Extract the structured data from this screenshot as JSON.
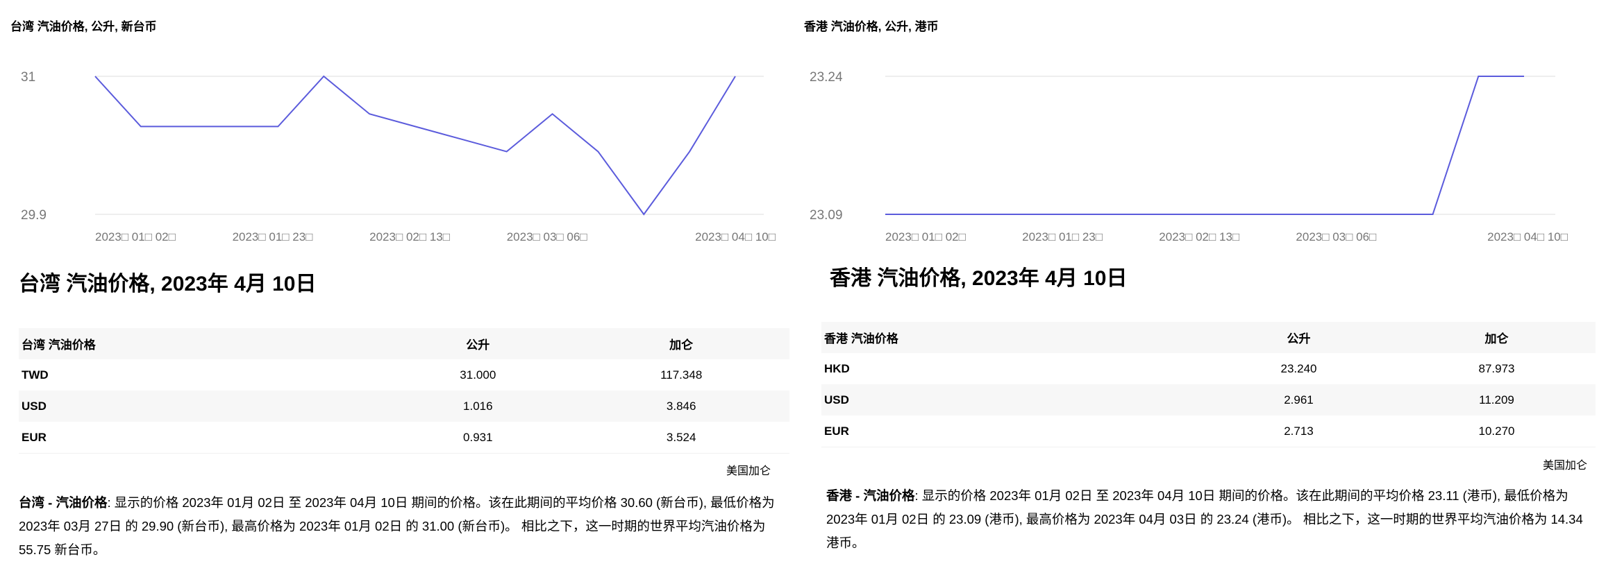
{
  "colors": {
    "line": "#5b5bdc",
    "grid": "#eeeeee",
    "axis_text": "#777777",
    "row_alt": "#f7f7f7"
  },
  "panels": [
    {
      "chart_title": "台湾 汽油价格, 公升, 新台币",
      "heading": "台湾 汽油价格, 2023年 4月 10日",
      "table": {
        "headers": [
          "台湾 汽油价格",
          "公升",
          "加仑"
        ],
        "rows": [
          [
            "TWD",
            "31.000",
            "117.348"
          ],
          [
            "USD",
            "1.016",
            "3.846"
          ],
          [
            "EUR",
            "0.931",
            "3.524"
          ]
        ]
      },
      "unit_note": "美国加仑",
      "summary_label": "台湾 - 汽油价格",
      "summary_text": ": 显示的价格 2023年 01月 02日 至 2023年 04月 10日 期间的价格。该在此期间的平均价格 30.60 (新台币), 最低价格为 2023年 03月 27日 的 29.90 (新台币), 最高价格为 2023年 01月 02日 的 31.00 (新台币)。 相比之下，这一时期的世界平均汽油价格为 55.75 新台币。"
    },
    {
      "chart_title": "香港 汽油价格, 公升, 港币",
      "heading": "香港 汽油价格, 2023年 4月 10日",
      "table": {
        "headers": [
          "香港 汽油价格",
          "公升",
          "加仑"
        ],
        "rows": [
          [
            "HKD",
            "23.240",
            "87.973"
          ],
          [
            "USD",
            "2.961",
            "11.209"
          ],
          [
            "EUR",
            "2.713",
            "10.270"
          ]
        ]
      },
      "unit_note": "美国加仑",
      "summary_label": "香港 - 汽油价格",
      "summary_text": ": 显示的价格 2023年 01月 02日 至 2023年 04月 10日 期间的价格。该在此期间的平均价格 23.11 (港币), 最低价格为 2023年 01月 02日 的 23.09 (港币), 最高价格为 2023年 04月 03日 的 23.24 (港币)。 相比之下，这一时期的世界平均汽油价格为 14.34 港币。"
    }
  ],
  "chart_data": [
    {
      "type": "line",
      "title": "台湾 汽油价格, 公升, 新台币",
      "x": [
        "2023-01-02",
        "2023-01-09",
        "2023-01-16",
        "2023-01-23",
        "2023-01-30",
        "2023-02-06",
        "2023-02-13",
        "2023-02-20",
        "2023-02-27",
        "2023-03-06",
        "2023-03-13",
        "2023-03-20",
        "2023-03-27",
        "2023-04-03",
        "2023-04-10"
      ],
      "series": [
        {
          "name": "台湾 汽油价格",
          "values": [
            31.0,
            30.6,
            30.6,
            30.6,
            30.6,
            31.0,
            30.7,
            30.6,
            30.5,
            30.4,
            30.7,
            30.4,
            29.9,
            30.4,
            31.0
          ]
        }
      ],
      "ylim": [
        29.9,
        31
      ],
      "yticks": [
        "31",
        "29.9"
      ],
      "ytick_values": [
        31,
        29.9
      ],
      "xtick_labels": [
        "2023□ 01□ 02□",
        "2023□ 01□ 23□",
        "2023□ 02□ 13□",
        "2023□ 03□ 06□",
        "2023□ 04□ 10□"
      ],
      "xtick_indices": [
        0,
        3,
        6,
        9,
        14
      ],
      "grid": true,
      "xlabel": "",
      "ylabel": ""
    },
    {
      "type": "line",
      "title": "香港 汽油价格, 公升, 港币",
      "x": [
        "2023-01-02",
        "2023-01-09",
        "2023-01-16",
        "2023-01-23",
        "2023-01-30",
        "2023-02-06",
        "2023-02-13",
        "2023-02-20",
        "2023-02-27",
        "2023-03-06",
        "2023-03-13",
        "2023-03-20",
        "2023-03-27",
        "2023-04-03",
        "2023-04-10"
      ],
      "series": [
        {
          "name": "香港 汽油价格",
          "values": [
            23.09,
            23.09,
            23.09,
            23.09,
            23.09,
            23.09,
            23.09,
            23.09,
            23.09,
            23.09,
            23.09,
            23.09,
            23.09,
            23.24,
            23.24
          ]
        }
      ],
      "ylim": [
        23.09,
        23.24
      ],
      "yticks": [
        "23.24",
        "23.09"
      ],
      "ytick_values": [
        23.24,
        23.09
      ],
      "xtick_labels": [
        "2023□ 01□ 02□",
        "2023□ 01□ 23□",
        "2023□ 02□ 13□",
        "2023□ 03□ 06□",
        "2023□ 04□ 10□"
      ],
      "xtick_indices": [
        0,
        3,
        6,
        9,
        14
      ],
      "grid": true,
      "xlabel": "",
      "ylabel": ""
    }
  ]
}
